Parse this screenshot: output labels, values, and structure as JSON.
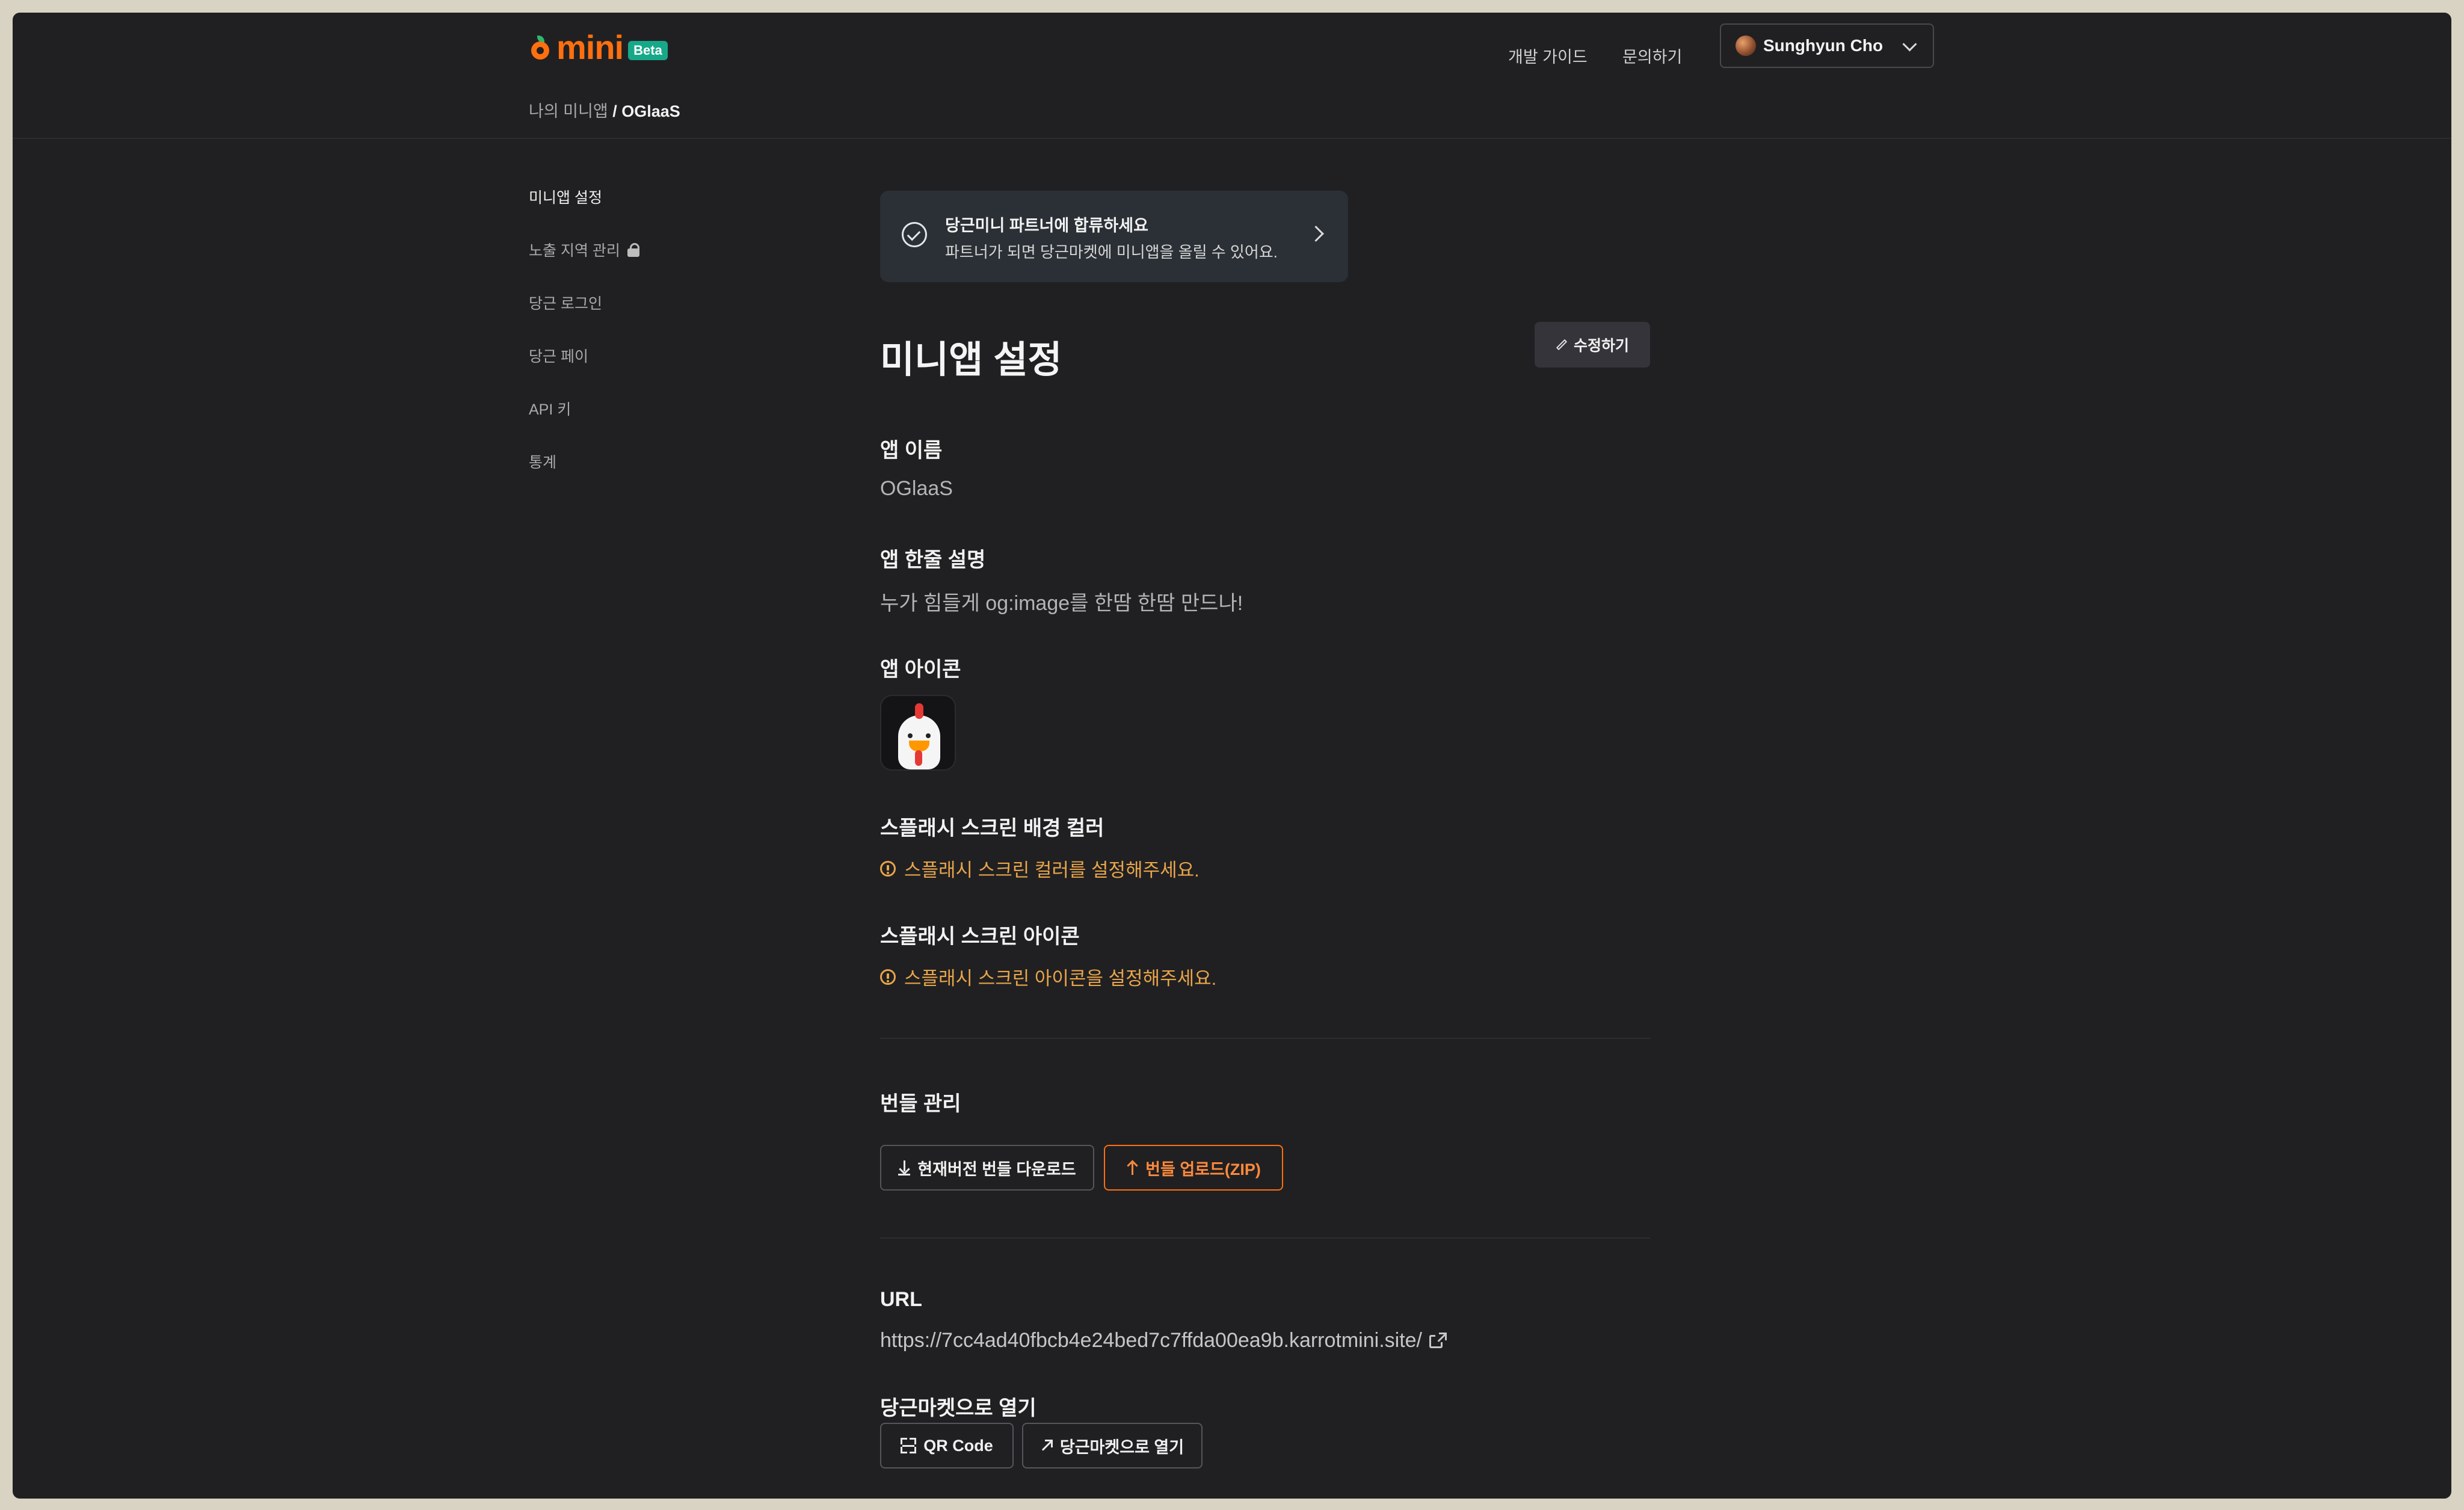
{
  "header": {
    "logo_text": "mini",
    "beta_badge": "Beta",
    "nav_guide": "개발 가이드",
    "nav_contact": "문의하기",
    "user_name": "Sunghyun Cho"
  },
  "breadcrumb": {
    "parent": "나의 미니앱",
    "separator": " / ",
    "current": "OGlaaS"
  },
  "sidebar": {
    "items": [
      {
        "label": "미니앱 설정",
        "active": true
      },
      {
        "label": "노출 지역 관리",
        "locked": true
      },
      {
        "label": "당근 로그인"
      },
      {
        "label": "당근 페이"
      },
      {
        "label": "API 키"
      },
      {
        "label": "통계"
      }
    ]
  },
  "banner": {
    "title": "당근미니 파트너에 합류하세요",
    "subtitle": "파트너가 되면 당근마켓에 미니앱을 올릴 수 있어요."
  },
  "page": {
    "title": "미니앱 설정",
    "edit_label": "수정하기"
  },
  "fields": {
    "app_name_label": "앱 이름",
    "app_name_value": "OGlaaS",
    "app_desc_label": "앱 한줄 설명",
    "app_desc_value": "누가 힘들게 og:image를 한땀 한땀 만드나!",
    "app_icon_label": "앱 아이콘",
    "splash_color_label": "스플래시 스크린 배경 컬러",
    "splash_color_warning": "스플래시 스크린 컬러를 설정해주세요.",
    "splash_icon_label": "스플래시 스크린 아이콘",
    "splash_icon_warning": "스플래시 스크린 아이콘을 설정해주세요."
  },
  "bundle": {
    "title": "번들 관리",
    "download_label": "현재버전 번들 다운로드",
    "upload_label": "번들 업로드(ZIP)"
  },
  "url": {
    "title": "URL",
    "value": "https://7cc4ad40fbcb4e24bed7c7ffda00ea9b.karrotmini.site/"
  },
  "open": {
    "title": "당근마켓으로 열기",
    "qr_label": "QR Code",
    "open_label": "당근마켓으로 열기"
  },
  "colors": {
    "accent": "#ff6f0f",
    "warning": "#e8a54a",
    "beta": "#17a88a",
    "background": "#202022"
  },
  "icons": [
    "carrot-logo-icon",
    "chevron-down-icon",
    "lock-icon",
    "check-circle-icon",
    "chevron-right-icon",
    "pencil-icon",
    "info-icon",
    "download-icon",
    "upload-icon",
    "external-link-icon",
    "qr-icon",
    "arrow-up-right-icon"
  ]
}
